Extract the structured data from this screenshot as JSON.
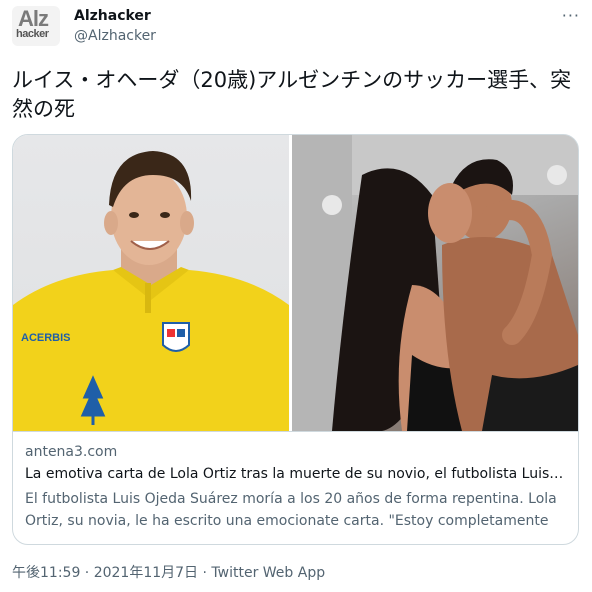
{
  "author": {
    "avatar_text_top": "Alz",
    "avatar_text_bottom": "hacker",
    "name": "Alzhacker",
    "handle": "@Alzhacker"
  },
  "more_icon": "more-horizontal-icon",
  "tweet": {
    "text": "ルイス・オヘーダ（20歳)アルゼンチンのサッカー選手、突然の死"
  },
  "card": {
    "domain": "antena3.com",
    "title": "La emotiva carta de Lola Ortiz tras la muerte de su novio, el futbolista Luis Ojed...",
    "description": "El futbolista Luis Ojeda Suárez moría a los 20 años de forma repentina. Lola Ortiz, su novia, le ha escrito una emocionate carta. \"Estoy completamente destrozada...."
  },
  "shirt_text": "ACERBIS",
  "timestamp": "午後11:59 · 2021年11月7日 · Twitter Web App",
  "colors": {
    "shirt_yellow": "#f2d21b",
    "shirt_blue": "#1f5fa8",
    "secondary_text": "#536471",
    "border": "#cfd9de"
  }
}
